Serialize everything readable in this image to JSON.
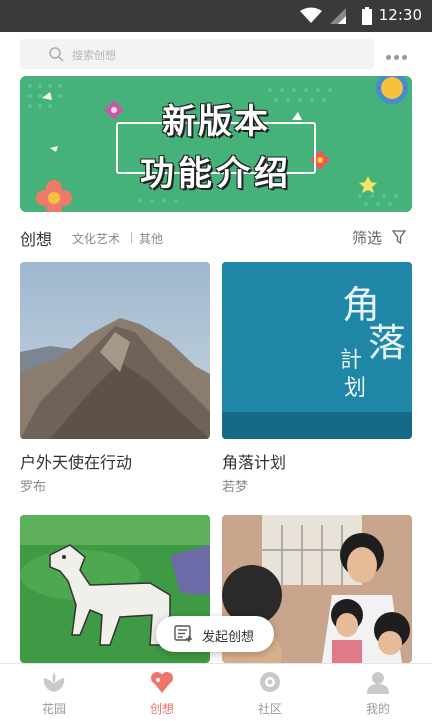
{
  "status_bar": {
    "time": "12:30"
  },
  "search": {
    "placeholder": "搜索创想"
  },
  "banner": {
    "line1": "新版本",
    "line2": "功能介绍"
  },
  "filter_row": {
    "title": "创想",
    "categories": [
      "文化艺术",
      "其他"
    ],
    "filter_label": "筛选"
  },
  "cards": [
    {
      "title": "户外天使在行动",
      "author": "罗布"
    },
    {
      "title": "角落计划",
      "author": "若梦",
      "cover_text": [
        "角",
        "落",
        "計",
        "划"
      ]
    },
    {
      "title": "",
      "author": ""
    },
    {
      "title": "",
      "author": ""
    }
  ],
  "fab": {
    "label": "发起创想"
  },
  "tabs": [
    {
      "label": "花园",
      "icon": "garden-icon",
      "active": false
    },
    {
      "label": "创想",
      "icon": "idea-icon",
      "active": true
    },
    {
      "label": "社区",
      "icon": "community-icon",
      "active": false
    },
    {
      "label": "我的",
      "icon": "profile-icon",
      "active": false
    }
  ],
  "colors": {
    "accent": "#f0736d",
    "banner_green": "#45b27a"
  }
}
